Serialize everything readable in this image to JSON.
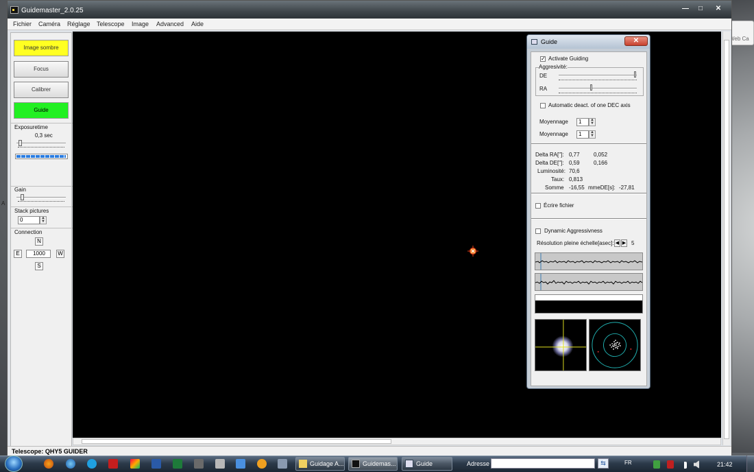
{
  "desktop": {
    "webcam_widget_label": "Web Ca",
    "desktop_letter": "A"
  },
  "app": {
    "title": "Guidemaster_2.0.25",
    "menu": [
      "Fichier",
      "Caméra",
      "Réglage",
      "Telescope",
      "Image",
      "Advanced",
      "Aide"
    ],
    "buttons": {
      "dark": "Image sombre",
      "focus": "Focus",
      "calibrate": "Calibrer",
      "guide": "Guide"
    },
    "exposure": {
      "label": "Exposuretime",
      "value": "0,3 sec",
      "progress_fraction": 0.98
    },
    "gain": {
      "label": "Gain"
    },
    "stack": {
      "label": "Stack pictures",
      "value": "0"
    },
    "connection": {
      "label": "Connection",
      "north": "N",
      "east": "E",
      "west": "W",
      "south": "S",
      "value": "1000"
    },
    "status": "Telescope: QHY5 GUIDER"
  },
  "guide": {
    "title": "Guide",
    "activate_label": "Activate Guiding",
    "activate_checked": "✓",
    "aggressivity_label": "Aggresivité:",
    "de_label": "DE",
    "ra_label": "RA",
    "auto_deact_label": "Automatic deact. of one DEC axis",
    "moyennage_ra_label": "Moyennage",
    "moyennage_ra_value": "1",
    "moyennage_de_label": "Moyennage",
    "moyennage_de_value": "1",
    "stats": [
      {
        "label": "Delta RA[\"]:",
        "v1": "0,77",
        "v2": "0,052"
      },
      {
        "label": "Delta DE[\"]:",
        "v1": "0,59",
        "v2": "0,166"
      },
      {
        "label": "Luminosité:",
        "v1": "70,6",
        "v2": ""
      },
      {
        "label": "Taux:",
        "v1": "0,813",
        "v2": ""
      },
      {
        "label": "Somme",
        "v1": "-16,55",
        "v2": "mmeDE[s]:",
        "v3": "-27,81"
      }
    ],
    "write_file_label": "Écrire fichier",
    "dynamic_label": "Dynamic Aggressivness",
    "resolution_label": "Résolution pleine échelle[asec]:",
    "resolution_value": "5"
  },
  "taskbar": {
    "tasks": [
      "Guidage A...",
      "Guidemas...",
      "Guide"
    ],
    "address_label": "Adresse",
    "language": "FR",
    "clock": "21:42"
  }
}
